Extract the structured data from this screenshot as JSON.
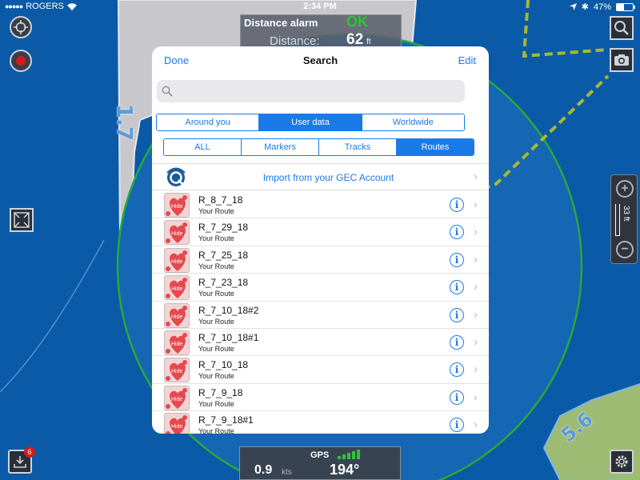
{
  "status_bar": {
    "carrier": "ROGERS",
    "time": "2:34 PM",
    "battery": "47%",
    "battery_fraction": 0.47
  },
  "map": {
    "depth_labels": [
      "1.7",
      "5.6"
    ],
    "colors": {
      "water": "#0a5aa8",
      "land": "#c8c8cc",
      "land_green": "#9dbb73",
      "circle": "#2aa83a",
      "route_line": "#a8b830"
    }
  },
  "distance_alarm": {
    "title": "Distance alarm",
    "status": "OK",
    "distance_label": "Distance:",
    "distance_value": "62",
    "distance_unit": "ft"
  },
  "zoom": {
    "level": "33",
    "unit": "ft"
  },
  "gps": {
    "label": "GPS",
    "signal_bars": 5,
    "speed": "0.9",
    "speed_unit": "kts",
    "heading": "194°"
  },
  "download_badge": "6",
  "search": {
    "done_label": "Done",
    "title": "Search",
    "edit_label": "Edit",
    "input_value": "",
    "scope_tabs": [
      {
        "label": "Around you",
        "selected": false
      },
      {
        "label": "User data",
        "selected": true
      },
      {
        "label": "Worldwide",
        "selected": false
      }
    ],
    "type_tabs": [
      {
        "label": "ALL",
        "selected": false
      },
      {
        "label": "Markers",
        "selected": false
      },
      {
        "label": "Tracks",
        "selected": false
      },
      {
        "label": "Routes",
        "selected": true
      }
    ],
    "import_label": "Import from your GEC Account",
    "thumb_label": "Hide",
    "routes": [
      {
        "name": "R_8_7_18",
        "subtitle": "Your Route"
      },
      {
        "name": "R_7_29_18",
        "subtitle": "Your Route"
      },
      {
        "name": "R_7_25_18",
        "subtitle": "Your Route"
      },
      {
        "name": "R_7_23_18",
        "subtitle": "Your Route"
      },
      {
        "name": "R_7_10_18#2",
        "subtitle": "Your Route"
      },
      {
        "name": "R_7_10_18#1",
        "subtitle": "Your Route"
      },
      {
        "name": "R_7_10_18",
        "subtitle": "Your Route"
      },
      {
        "name": "R_7_9_18",
        "subtitle": "Your Route"
      },
      {
        "name": "R_7_9_18#1",
        "subtitle": "Your Route"
      }
    ]
  }
}
